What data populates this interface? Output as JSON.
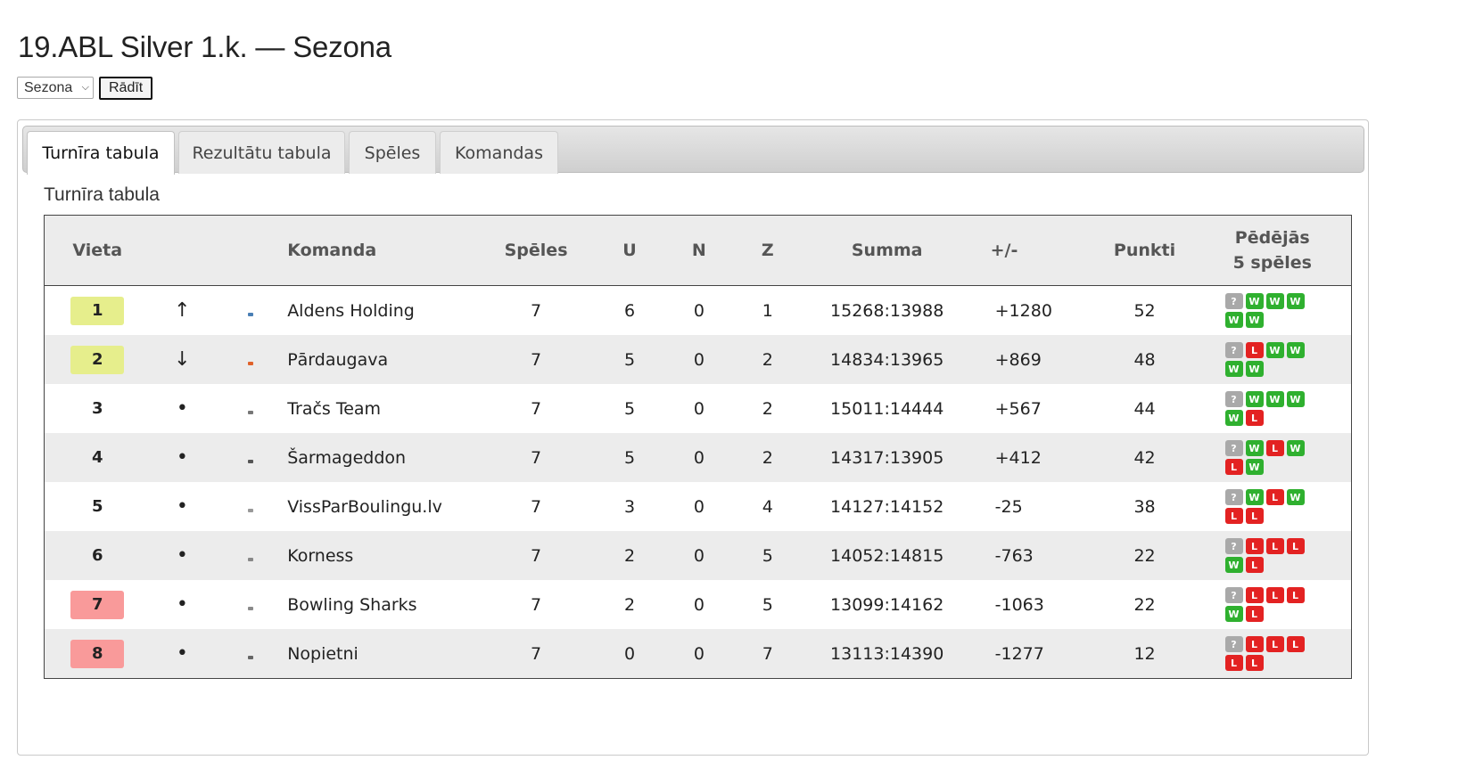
{
  "page": {
    "title": "19.ABL Silver 1.k. — Sezona"
  },
  "filter": {
    "select_value": "Sezona",
    "button_label": "Rādīt"
  },
  "tabs": [
    {
      "label": "Turnīra tabula",
      "active": true
    },
    {
      "label": "Rezultātu tabula",
      "active": false
    },
    {
      "label": "Spēles",
      "active": false
    },
    {
      "label": "Komandas",
      "active": false
    }
  ],
  "section": {
    "title": "Turnīra tabula"
  },
  "table": {
    "headers": {
      "place": "Vieta",
      "team": "Komanda",
      "games": "Spēles",
      "wins": "U",
      "draws": "N",
      "losses": "Z",
      "sum": "Summa",
      "diff": "+/-",
      "points": "Punkti",
      "last5_line1": "Pēdējās",
      "last5_line2": "5 spēles"
    },
    "colors": {
      "promotion": "#e6ee8c",
      "relegation": "#f99a9a",
      "win": "#2fb02f",
      "loss": "#e32222",
      "unknown": "#a9a9a9"
    },
    "rows": [
      {
        "place": "1",
        "zone": "up",
        "trend": "↑",
        "team": "Aldens Holding",
        "games": "7",
        "wins": "6",
        "draws": "0",
        "losses": "1",
        "sum": "15268:13988",
        "diff": "+1280",
        "points": "52",
        "form": [
          "?",
          "W",
          "W",
          "W",
          "W",
          "W"
        ]
      },
      {
        "place": "2",
        "zone": "up",
        "trend": "↓",
        "team": "Pārdaugava",
        "games": "7",
        "wins": "5",
        "draws": "0",
        "losses": "2",
        "sum": "14834:13965",
        "diff": "+869",
        "points": "48",
        "form": [
          "?",
          "L",
          "W",
          "W",
          "W",
          "W"
        ]
      },
      {
        "place": "3",
        "zone": "",
        "trend": "•",
        "team": "Tračs Team",
        "games": "7",
        "wins": "5",
        "draws": "0",
        "losses": "2",
        "sum": "15011:14444",
        "diff": "+567",
        "points": "44",
        "form": [
          "?",
          "W",
          "W",
          "W",
          "W",
          "L"
        ]
      },
      {
        "place": "4",
        "zone": "",
        "trend": "•",
        "team": "Šarmageddon",
        "games": "7",
        "wins": "5",
        "draws": "0",
        "losses": "2",
        "sum": "14317:13905",
        "diff": "+412",
        "points": "42",
        "form": [
          "?",
          "W",
          "L",
          "W",
          "L",
          "W"
        ]
      },
      {
        "place": "5",
        "zone": "",
        "trend": "•",
        "team": "VissParBoulingu.lv",
        "games": "7",
        "wins": "3",
        "draws": "0",
        "losses": "4",
        "sum": "14127:14152",
        "diff": "-25",
        "points": "38",
        "form": [
          "?",
          "W",
          "L",
          "W",
          "L",
          "L"
        ]
      },
      {
        "place": "6",
        "zone": "",
        "trend": "•",
        "team": "Korness",
        "games": "7",
        "wins": "2",
        "draws": "0",
        "losses": "5",
        "sum": "14052:14815",
        "diff": "-763",
        "points": "22",
        "form": [
          "?",
          "L",
          "L",
          "L",
          "W",
          "L"
        ]
      },
      {
        "place": "7",
        "zone": "down",
        "trend": "•",
        "team": "Bowling Sharks",
        "games": "7",
        "wins": "2",
        "draws": "0",
        "losses": "5",
        "sum": "13099:14162",
        "diff": "-1063",
        "points": "22",
        "form": [
          "?",
          "L",
          "L",
          "L",
          "W",
          "L"
        ]
      },
      {
        "place": "8",
        "zone": "down",
        "trend": "•",
        "team": "Nopietni",
        "games": "7",
        "wins": "0",
        "draws": "0",
        "losses": "7",
        "sum": "13113:14390",
        "diff": "-1277",
        "points": "12",
        "form": [
          "?",
          "L",
          "L",
          "L",
          "L",
          "L"
        ]
      }
    ]
  }
}
